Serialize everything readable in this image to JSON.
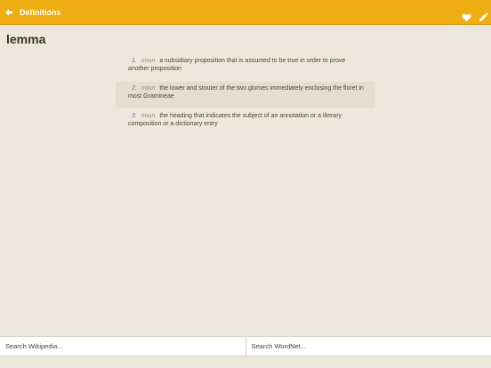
{
  "header": {
    "title": "Definitions",
    "back_icon": "arrow-left-icon",
    "favorite_icon": "heart-icon",
    "edit_icon": "pencil-icon",
    "bar_color": "#efad14",
    "icon_color": "#ffffff"
  },
  "entry": {
    "word": "lemma",
    "definitions": [
      {
        "number": "1.",
        "pos": "noun",
        "gloss": "a subsidiary proposition that is assumed to be true in order to prove another proposition"
      },
      {
        "number": "2.",
        "pos": "noun",
        "gloss": "the lower and stouter of the two glumes immediately enclosing the floret in most Gramineae"
      },
      {
        "number": "3.",
        "pos": "noun",
        "gloss": "the heading that indicates the subject of an annotation or a literary composition or a dictionary entry"
      }
    ]
  },
  "search": {
    "wikipedia_placeholder": "Search Wikipedia...",
    "wordnet_placeholder": "Search WordNet..."
  }
}
